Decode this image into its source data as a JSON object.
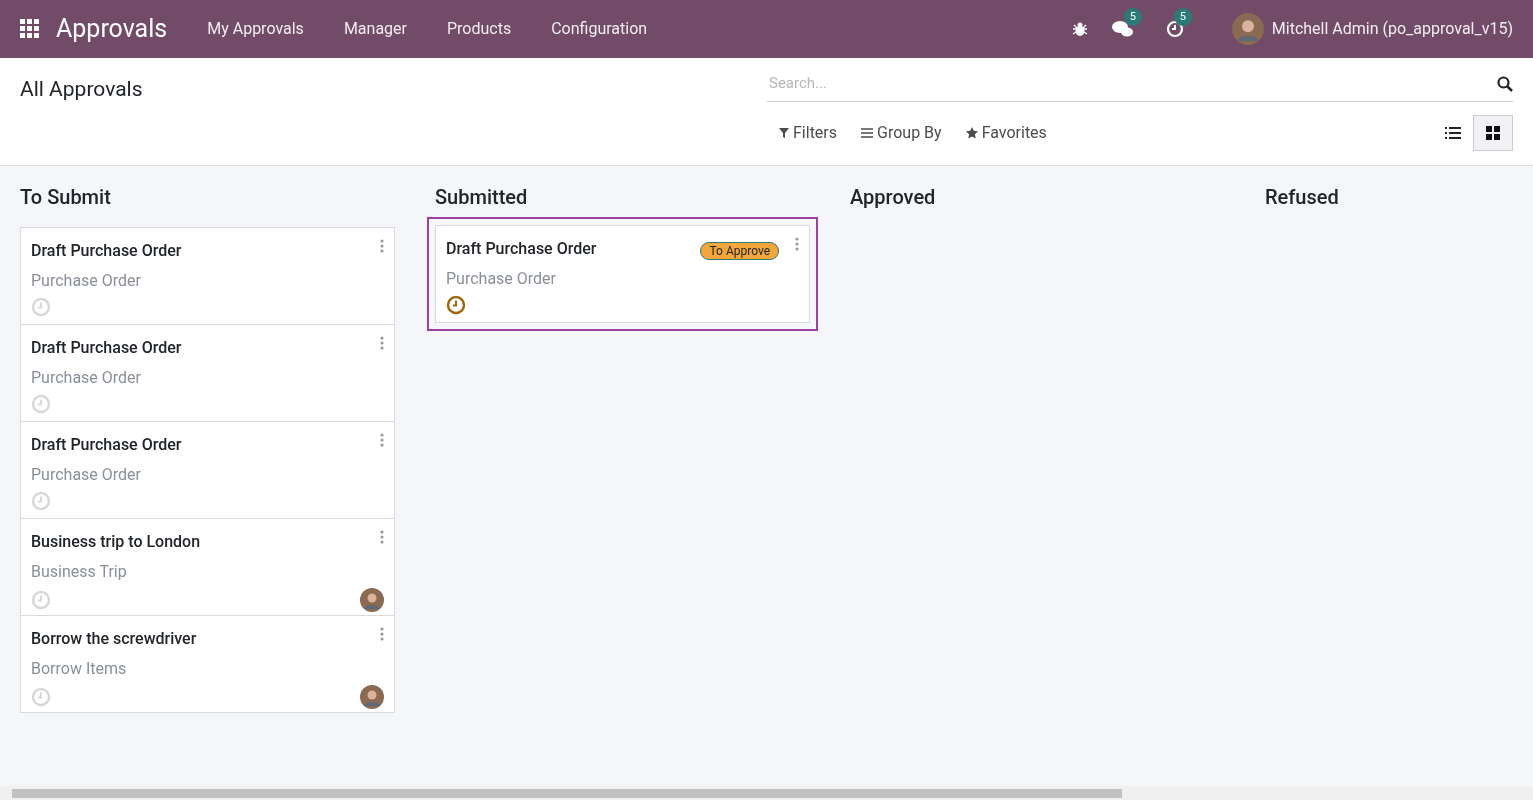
{
  "navbar": {
    "app_title": "Approvals",
    "menu": [
      "My Approvals",
      "Manager",
      "Products",
      "Configuration"
    ],
    "messages_count": "5",
    "activities_count": "5",
    "user": "Mitchell Admin (po_approval_v15)"
  },
  "control_panel": {
    "breadcrumb": "All Approvals",
    "search": {
      "placeholder": "Search..."
    },
    "filters": [
      "Filters",
      "Group By",
      "Favorites"
    ],
    "views": [
      {
        "kind": "list",
        "selected": false
      },
      {
        "kind": "kanban",
        "selected": true
      }
    ]
  },
  "columns": [
    {
      "title": "To Submit",
      "cards": [
        {
          "title": "Draft Purchase Order",
          "subtitle": "Purchase Order",
          "activity_scheduled": false,
          "avatar": false,
          "selected": false
        },
        {
          "title": "Draft Purchase Order",
          "subtitle": "Purchase Order",
          "activity_scheduled": false,
          "avatar": false,
          "selected": false
        },
        {
          "title": "Draft Purchase Order",
          "subtitle": "Purchase Order",
          "activity_scheduled": false,
          "avatar": false,
          "selected": false
        },
        {
          "title": "Business trip to London",
          "subtitle": "Business Trip",
          "activity_scheduled": false,
          "avatar": true,
          "selected": false
        },
        {
          "title": "Borrow the screwdriver",
          "subtitle": "Borrow Items",
          "activity_scheduled": false,
          "avatar": true,
          "selected": false
        }
      ]
    },
    {
      "title": "Submitted",
      "cards": [
        {
          "title": "Draft Purchase Order",
          "subtitle": "Purchase Order",
          "badge": "To Approve",
          "activity_scheduled": true,
          "avatar": false,
          "selected": true
        }
      ]
    },
    {
      "title": "Approved"
    },
    {
      "title": "Refused"
    }
  ]
}
